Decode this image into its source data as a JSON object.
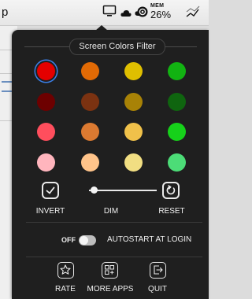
{
  "menubar": {
    "app_name_fragment": "p",
    "memory": {
      "label": "MEM",
      "value": "26%"
    },
    "icons": [
      "display-icon",
      "cloud-icon",
      "creative-cloud-icon",
      "vpn-icon",
      "stats-icon"
    ]
  },
  "popover": {
    "title": "Screen Colors Filter",
    "swatches": [
      [
        "#e40000",
        "#e16a05",
        "#dfbf00",
        "#12b312"
      ],
      [
        "#6d0000",
        "#7b3211",
        "#a88206",
        "#0f650f"
      ],
      [
        "#ff4e5d",
        "#dc7a31",
        "#f0c14a",
        "#16d11a"
      ],
      [
        "#ffb5bd",
        "#ffc48a",
        "#f1de82",
        "#4cdc77"
      ]
    ],
    "selected_swatch": "#e40000",
    "controls": {
      "invert_label": "INVERT",
      "dim_label": "DIM",
      "reset_label": "RESET",
      "dim_level": 0.05
    },
    "autostart": {
      "state_label": "OFF",
      "label": "AUTOSTART AT LOGIN",
      "enabled": false
    },
    "footer": {
      "rate_label": "RATE",
      "more_apps_label": "MORE APPS",
      "quit_label": "QUIT"
    }
  }
}
